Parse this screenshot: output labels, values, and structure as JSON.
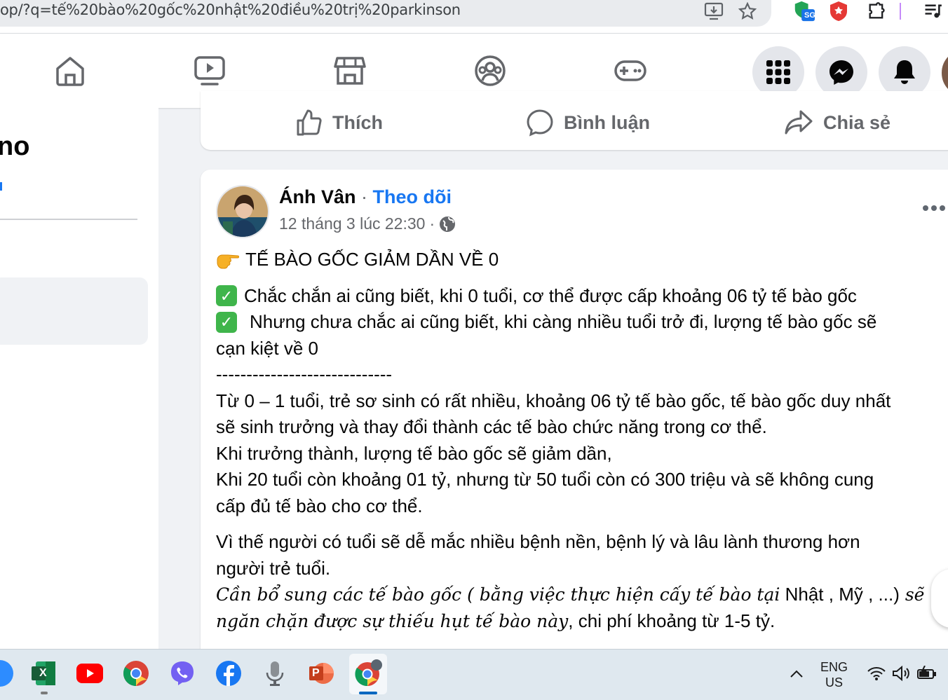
{
  "browser": {
    "url": "op/?q=tế%20bào%20gốc%20nhật%20điều%20trị%20parkinson",
    "extension_badge": "SG"
  },
  "left_panel": {
    "title_fragment": "no"
  },
  "prev_post_actions": {
    "like": "Thích",
    "comment": "Bình luận",
    "share": "Chia sẻ"
  },
  "post": {
    "author": "Ánh Vân",
    "separator": "·",
    "follow": "Theo dõi",
    "timestamp": "12 tháng 3 lúc 22:30",
    "meta_separator": "·",
    "body": {
      "heading": "TẾ BÀO GỐC GIẢM DẦN VỀ 0",
      "check_1": "Chắc chắn ai cũng biết, khi 0 tuổi, cơ thể được cấp khoảng 06 tỷ tế bào gốc",
      "check_2": "Nhưng chưa chắc ai cũng biết, khi càng nhiều tuổi trở đi, lượng tế bào gốc sẽ",
      "check_2_cont": "cạn kiệt về 0",
      "divider": "-----------------------------",
      "p1_l1": "Từ 0 – 1 tuổi, trẻ sơ sinh có rất nhiều, khoảng 06 tỷ tế bào gốc, tế bào gốc duy nhất",
      "p1_l2": "sẽ sinh trưởng và thay đổi thành các tế bào chức năng trong cơ thể.",
      "p1_l3": "Khi trưởng thành, lượng tế bào gốc sẽ giảm dần,",
      "p1_l4": "Khi 20 tuổi còn khoảng 01 tỷ, nhưng từ 50 tuổi còn có 300 triệu và sẽ không cung",
      "p1_l5": "cấp đủ tế bào cho cơ thể.",
      "p2_l1": "Vì thế người có tuổi sẽ dễ mắc nhiều bệnh nền, bệnh lý và lâu lành thương hơn",
      "p2_l2": "người trẻ tuổi.",
      "p3_l1_italic": "Cần bổ sung các tế bào gốc ( bằng việc thực hiện cấy tế bào tại",
      "p3_l1_normal": " Nhật , Mỹ , ...)",
      "p3_l1_italic2": " sẽ",
      "p3_l2_italic": "ngăn chặn được sự thiếu hụt tế bào này",
      "p3_l2_normal": ", chi phí khoảng từ 1-5 tỷ."
    }
  },
  "taskbar": {
    "lang_1": "ENG",
    "lang_2": "US",
    "powerpoint_letter": "P",
    "excel_letter": "X"
  },
  "colors": {
    "fb_blue": "#1877f2",
    "check_green": "#3fb54b",
    "text_secondary": "#65676b"
  }
}
